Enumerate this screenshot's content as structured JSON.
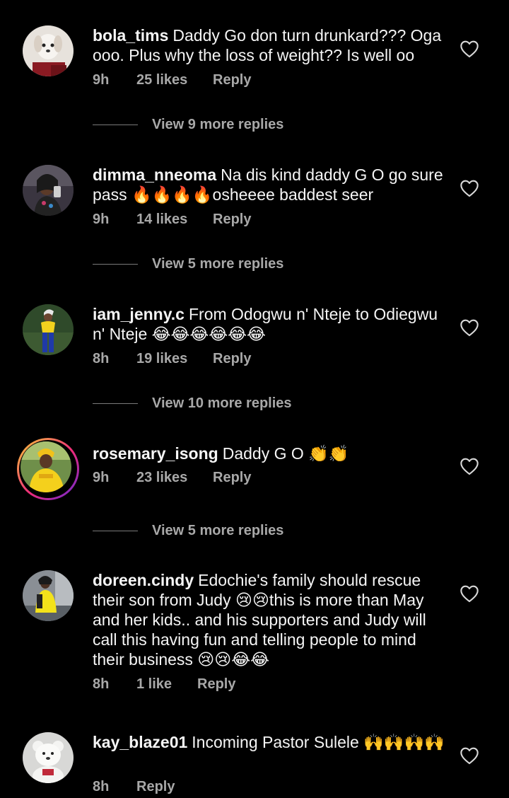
{
  "colors": {
    "background": "#000000",
    "text_primary": "#f5f5f5",
    "text_secondary": "#a8a8a8",
    "story_ring": [
      "#f9ce34",
      "#ee2a7b",
      "#6228d7"
    ]
  },
  "comments": [
    {
      "username": "bola_tims",
      "text": "Daddy Go don turn drunkard??? Oga ooo. Plus why the loss of weight?? Is well oo",
      "time": "9h",
      "likes": "25 likes",
      "reply": "Reply",
      "view_replies": "View 9 more replies",
      "avatar_icon": "dog-photo-avatar"
    },
    {
      "username": "dimma_nneoma",
      "text": "Na dis kind daddy G O go sure pass 🔥🔥🔥🔥osheeee baddest seer",
      "time": "9h",
      "likes": "14 likes",
      "reply": "Reply",
      "view_replies": "View 5 more replies",
      "avatar_icon": "woman-selfie-avatar"
    },
    {
      "username": "iam_jenny.c",
      "text": "From Odogwu n' Nteje to Odiegwu n' Nteje 😂😂😂😂😂😂",
      "time": "8h",
      "likes": "19 likes",
      "reply": "Reply",
      "view_replies": "View 10 more replies",
      "avatar_icon": "woman-yellow-top-avatar"
    },
    {
      "username": "rosemary_isong",
      "text": "Daddy G O 👏👏",
      "time": "9h",
      "likes": "23 likes",
      "reply": "Reply",
      "view_replies": "View 5 more replies",
      "avatar_icon": "woman-yellow-outfit-avatar"
    },
    {
      "username": "doreen.cindy",
      "text": "Edochie's family should rescue their son from Judy 😢😢this is more than May and her kids.. and his supporters and Judy will call this having fun and telling people to mind their business 😢😢😂😂",
      "time": "8h",
      "likes": "1 like",
      "reply": "Reply",
      "avatar_icon": "woman-yellow-dress-avatar"
    },
    {
      "username": "kay_blaze01",
      "text": "Incoming Pastor Sulele 🙌🙌🙌🙌",
      "time": "8h",
      "reply": "Reply",
      "avatar_icon": "teddy-bear-avatar"
    }
  ]
}
